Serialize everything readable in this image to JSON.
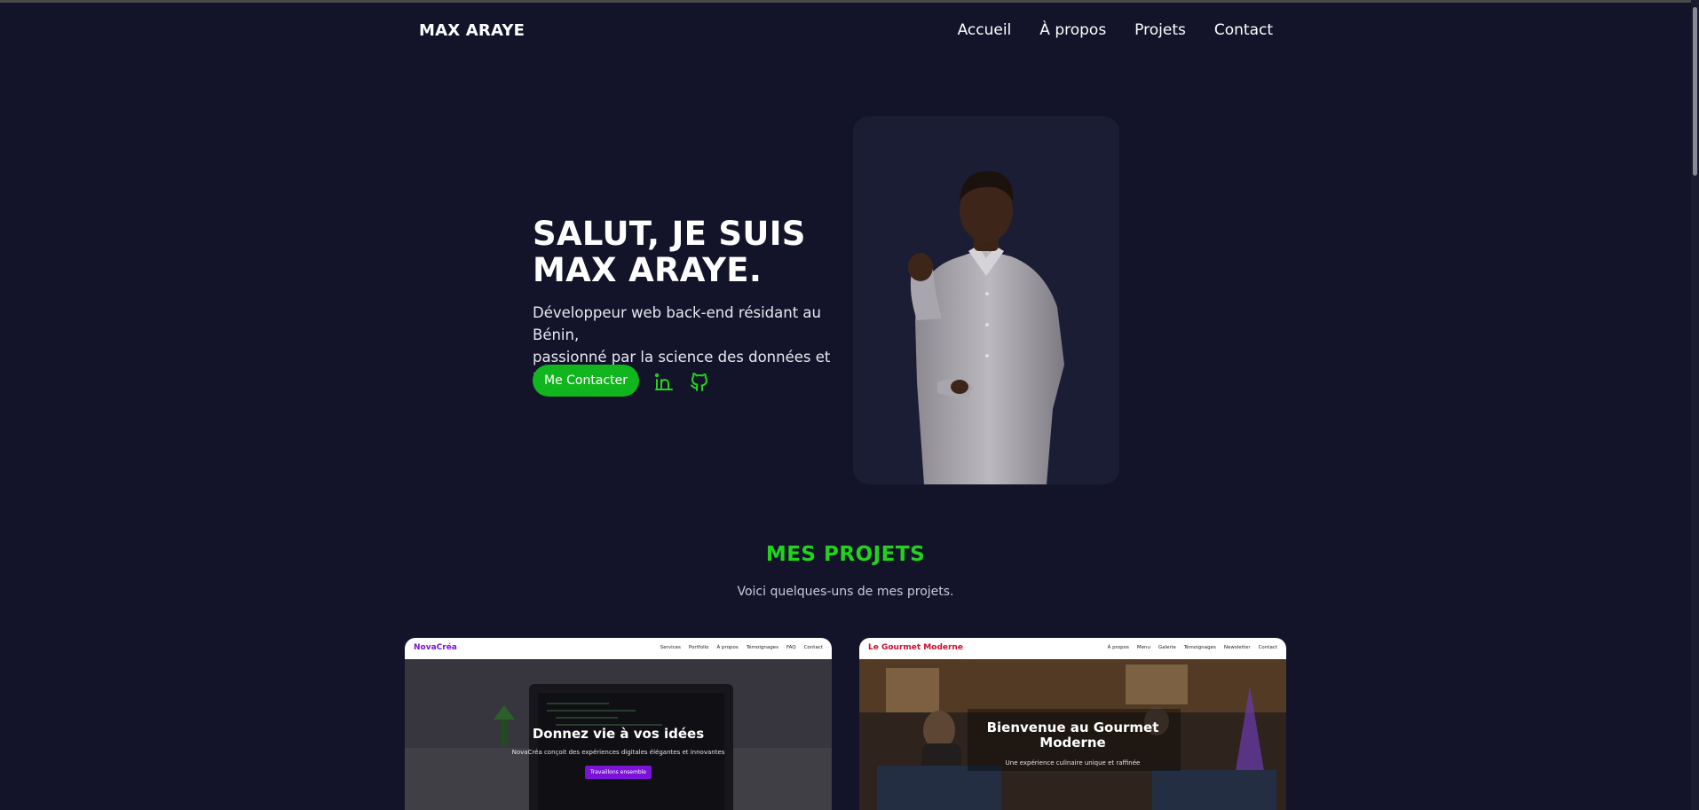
{
  "nav": {
    "brand": "MAX ARAYE",
    "links": [
      "Accueil",
      "À propos",
      "Projets",
      "Contact"
    ]
  },
  "hero": {
    "title_line1": "SALUT, JE SUIS",
    "title_line2": "MAX ARAYE.",
    "subtitle_line1": "Développeur web back-end résidant au Bénin,",
    "subtitle_line2": "passionné par la science des données et l'IA.",
    "cta_label": "Me Contacter",
    "social_icons": [
      "linkedin-icon",
      "github-icon"
    ]
  },
  "projects_section": {
    "title": "MES PROJETS",
    "subtitle": "Voici quelques-uns de mes projets."
  },
  "projects": [
    {
      "logo": "NovaCréa",
      "links": [
        "Services",
        "Portfolio",
        "À propos",
        "Témoignages",
        "FAQ",
        "Contact"
      ],
      "headline": "Donnez vie à vos idées",
      "description": "NovaCréa conçoit des expériences digitales élégantes et innovantes",
      "button": "Travaillons ensemble"
    },
    {
      "logo": "Le Gourmet Moderne",
      "links": [
        "À propos",
        "Menu",
        "Galerie",
        "Témoignages",
        "Newsletter",
        "Contact"
      ],
      "headline_line1": "Bienvenue au Gourmet",
      "headline_line2": "Moderne",
      "description": "Une expérience culinaire unique et raffinée"
    }
  ],
  "colors": {
    "background": "#13142a",
    "accent_green": "#11b51d",
    "section_title_green": "#22d21d",
    "novacrea_purple": "#7a12d8",
    "gourmet_red": "#c8102e"
  }
}
